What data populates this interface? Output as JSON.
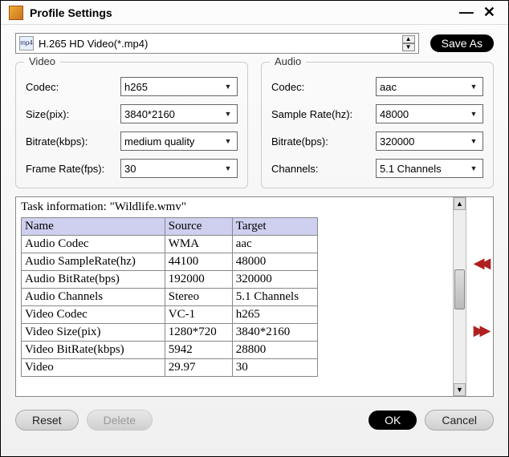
{
  "window": {
    "title": "Profile Settings"
  },
  "profile": {
    "name": "H.265 HD Video(*.mp4)",
    "icon_hint": "mp4"
  },
  "buttons": {
    "save_as": "Save As",
    "reset": "Reset",
    "delete": "Delete",
    "ok": "OK",
    "cancel": "Cancel"
  },
  "video": {
    "legend": "Video",
    "codec_label": "Codec:",
    "codec": "h265",
    "size_label": "Size(pix):",
    "size": "3840*2160",
    "bitrate_label": "Bitrate(kbps):",
    "bitrate": "medium quality",
    "framerate_label": "Frame Rate(fps):",
    "framerate": "30"
  },
  "audio": {
    "legend": "Audio",
    "codec_label": "Codec:",
    "codec": "aac",
    "samplerate_label": "Sample Rate(hz):",
    "samplerate": "48000",
    "bitrate_label": "Bitrate(bps):",
    "bitrate": "320000",
    "channels_label": "Channels:",
    "channels": "5.1 Channels"
  },
  "task": {
    "header": "Task information: \"Wildlife.wmv\"",
    "columns": [
      "Name",
      "Source",
      "Target"
    ],
    "rows": [
      [
        "Audio Codec",
        "WMA",
        "aac"
      ],
      [
        "Audio SampleRate(hz)",
        "44100",
        "48000"
      ],
      [
        "Audio BitRate(bps)",
        "192000",
        "320000"
      ],
      [
        "Audio Channels",
        "Stereo",
        "5.1 Channels"
      ],
      [
        "Video Codec",
        "VC-1",
        "h265"
      ],
      [
        "Video Size(pix)",
        "1280*720",
        "3840*2160"
      ],
      [
        "Video BitRate(kbps)",
        "5942",
        "28800"
      ],
      [
        "Video",
        "29.97",
        "30"
      ]
    ]
  }
}
